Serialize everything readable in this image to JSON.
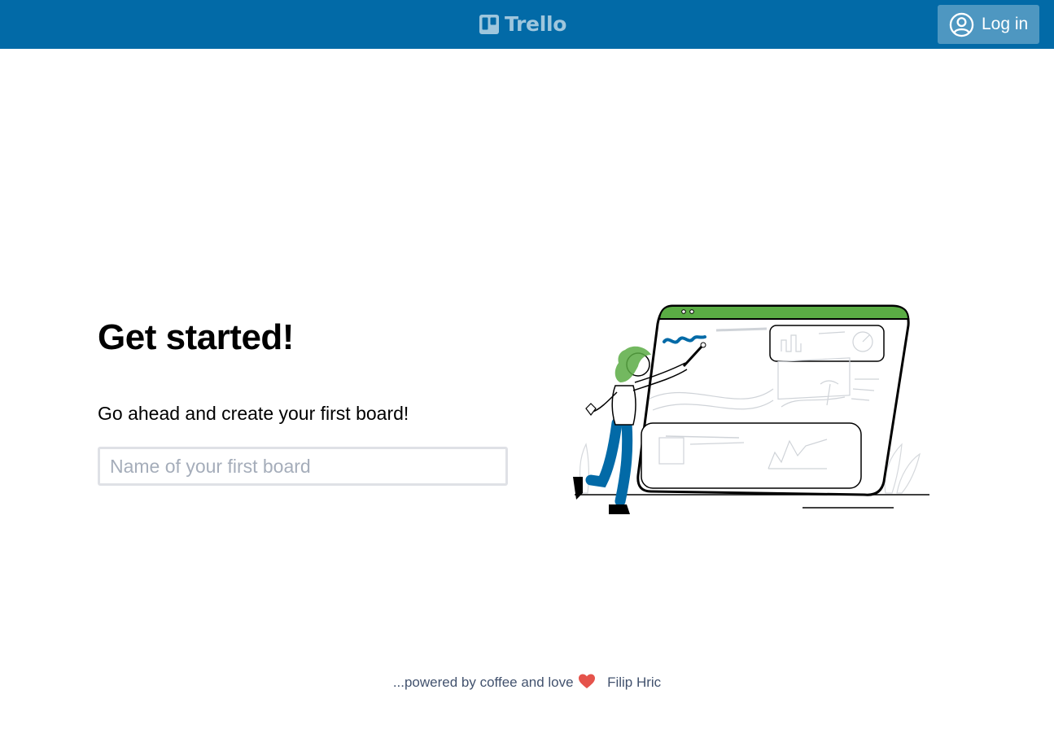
{
  "header": {
    "logo_text": "Trello",
    "logo_icon": "trello-board-icon",
    "login_label": "Log in",
    "login_icon": "user-circle-icon",
    "background_color": "#026aa7"
  },
  "main": {
    "title": "Get started!",
    "subtitle": "Go ahead and create your first board!",
    "board_input": {
      "placeholder": "Name of your first board",
      "value": ""
    },
    "illustration_icon": "person-painting-board-illustration",
    "accent_color": "#5aac44"
  },
  "footer": {
    "text": "...powered by coffee and love",
    "heart_icon": "heart-icon",
    "author_link": "Filip Hric"
  }
}
